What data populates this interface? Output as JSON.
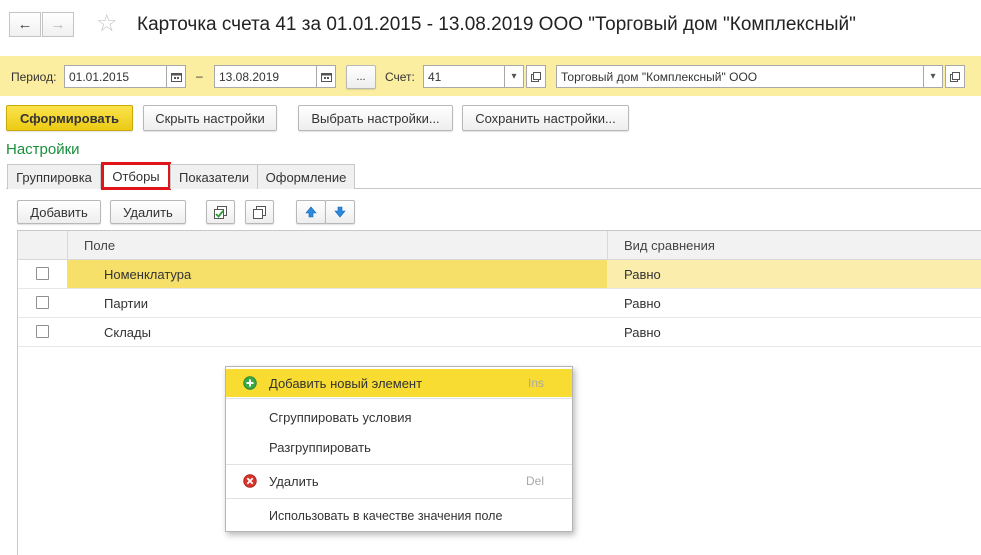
{
  "window": {
    "title": "Карточка счета 41 за 01.01.2015 - 13.08.2019 ООО \"Торговый дом \"Комплексный\""
  },
  "params": {
    "period_label": "Период:",
    "date_from": "01.01.2015",
    "dash": "–",
    "date_to": "13.08.2019",
    "ellipsis": "...",
    "account_label": "Счет:",
    "account_value": "41",
    "org_value": "Торговый дом \"Комплексный\" ООО"
  },
  "toolbar": {
    "generate": "Сформировать",
    "hide_settings": "Скрыть настройки",
    "choose_settings": "Выбрать настройки...",
    "save_settings": "Сохранить настройки..."
  },
  "settings": {
    "heading": "Настройки",
    "tabs": [
      {
        "label": "Группировка"
      },
      {
        "label": "Отборы"
      },
      {
        "label": "Показатели"
      },
      {
        "label": "Оформление"
      }
    ],
    "add_button": "Добавить",
    "delete_button": "Удалить"
  },
  "table": {
    "columns": [
      "Поле",
      "Вид сравнения"
    ],
    "rows": [
      {
        "field": "Номенклатура",
        "comparison": "Равно",
        "selected": true
      },
      {
        "field": "Партии",
        "comparison": "Равно",
        "selected": false
      },
      {
        "field": "Склады",
        "comparison": "Равно",
        "selected": false
      }
    ]
  },
  "context_menu": {
    "items": [
      {
        "label": "Добавить новый элемент",
        "shortcut": "Ins",
        "icon": "add-circle-icon"
      },
      {
        "label": "Сгруппировать условия",
        "shortcut": ""
      },
      {
        "label": "Разгруппировать",
        "shortcut": ""
      },
      {
        "label": "Удалить",
        "shortcut": "Del",
        "icon": "delete-circle-icon"
      },
      {
        "label": "Использовать в качестве значения поле",
        "shortcut": ""
      }
    ]
  },
  "colors": {
    "accent_yellow": "#f5dd2c",
    "params_bar": "#fbeea0",
    "selected_row": "#fbeeac",
    "settings_green": "#1a8f3c",
    "tab_highlight": "#e0151a"
  }
}
